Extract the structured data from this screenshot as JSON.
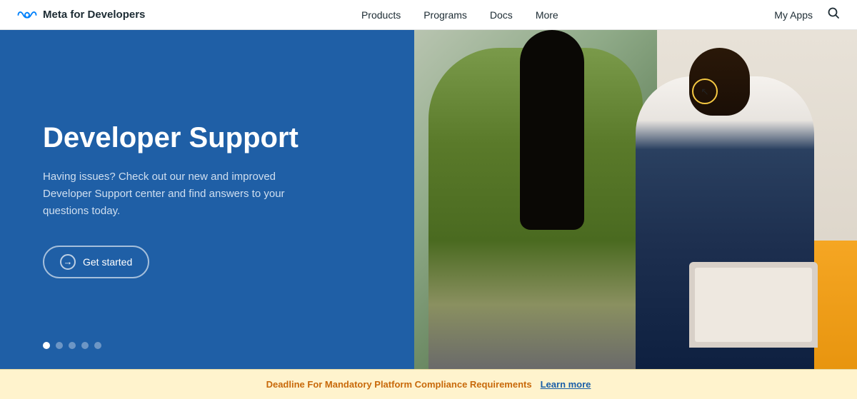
{
  "nav": {
    "brand": "Meta for Developers",
    "links": [
      {
        "label": "Products",
        "id": "products"
      },
      {
        "label": "Programs",
        "id": "programs"
      },
      {
        "label": "Docs",
        "id": "docs"
      },
      {
        "label": "More",
        "id": "more"
      }
    ],
    "myApps": "My Apps"
  },
  "hero": {
    "title": "Developer Support",
    "subtitle": "Having issues? Check out our new and improved Developer Support center and find answers to your questions today.",
    "cta": "Get started",
    "dots": [
      true,
      false,
      false,
      false,
      false
    ]
  },
  "banner": {
    "text": "Deadline For Mandatory Platform Compliance Requirements",
    "link": "Learn more"
  }
}
